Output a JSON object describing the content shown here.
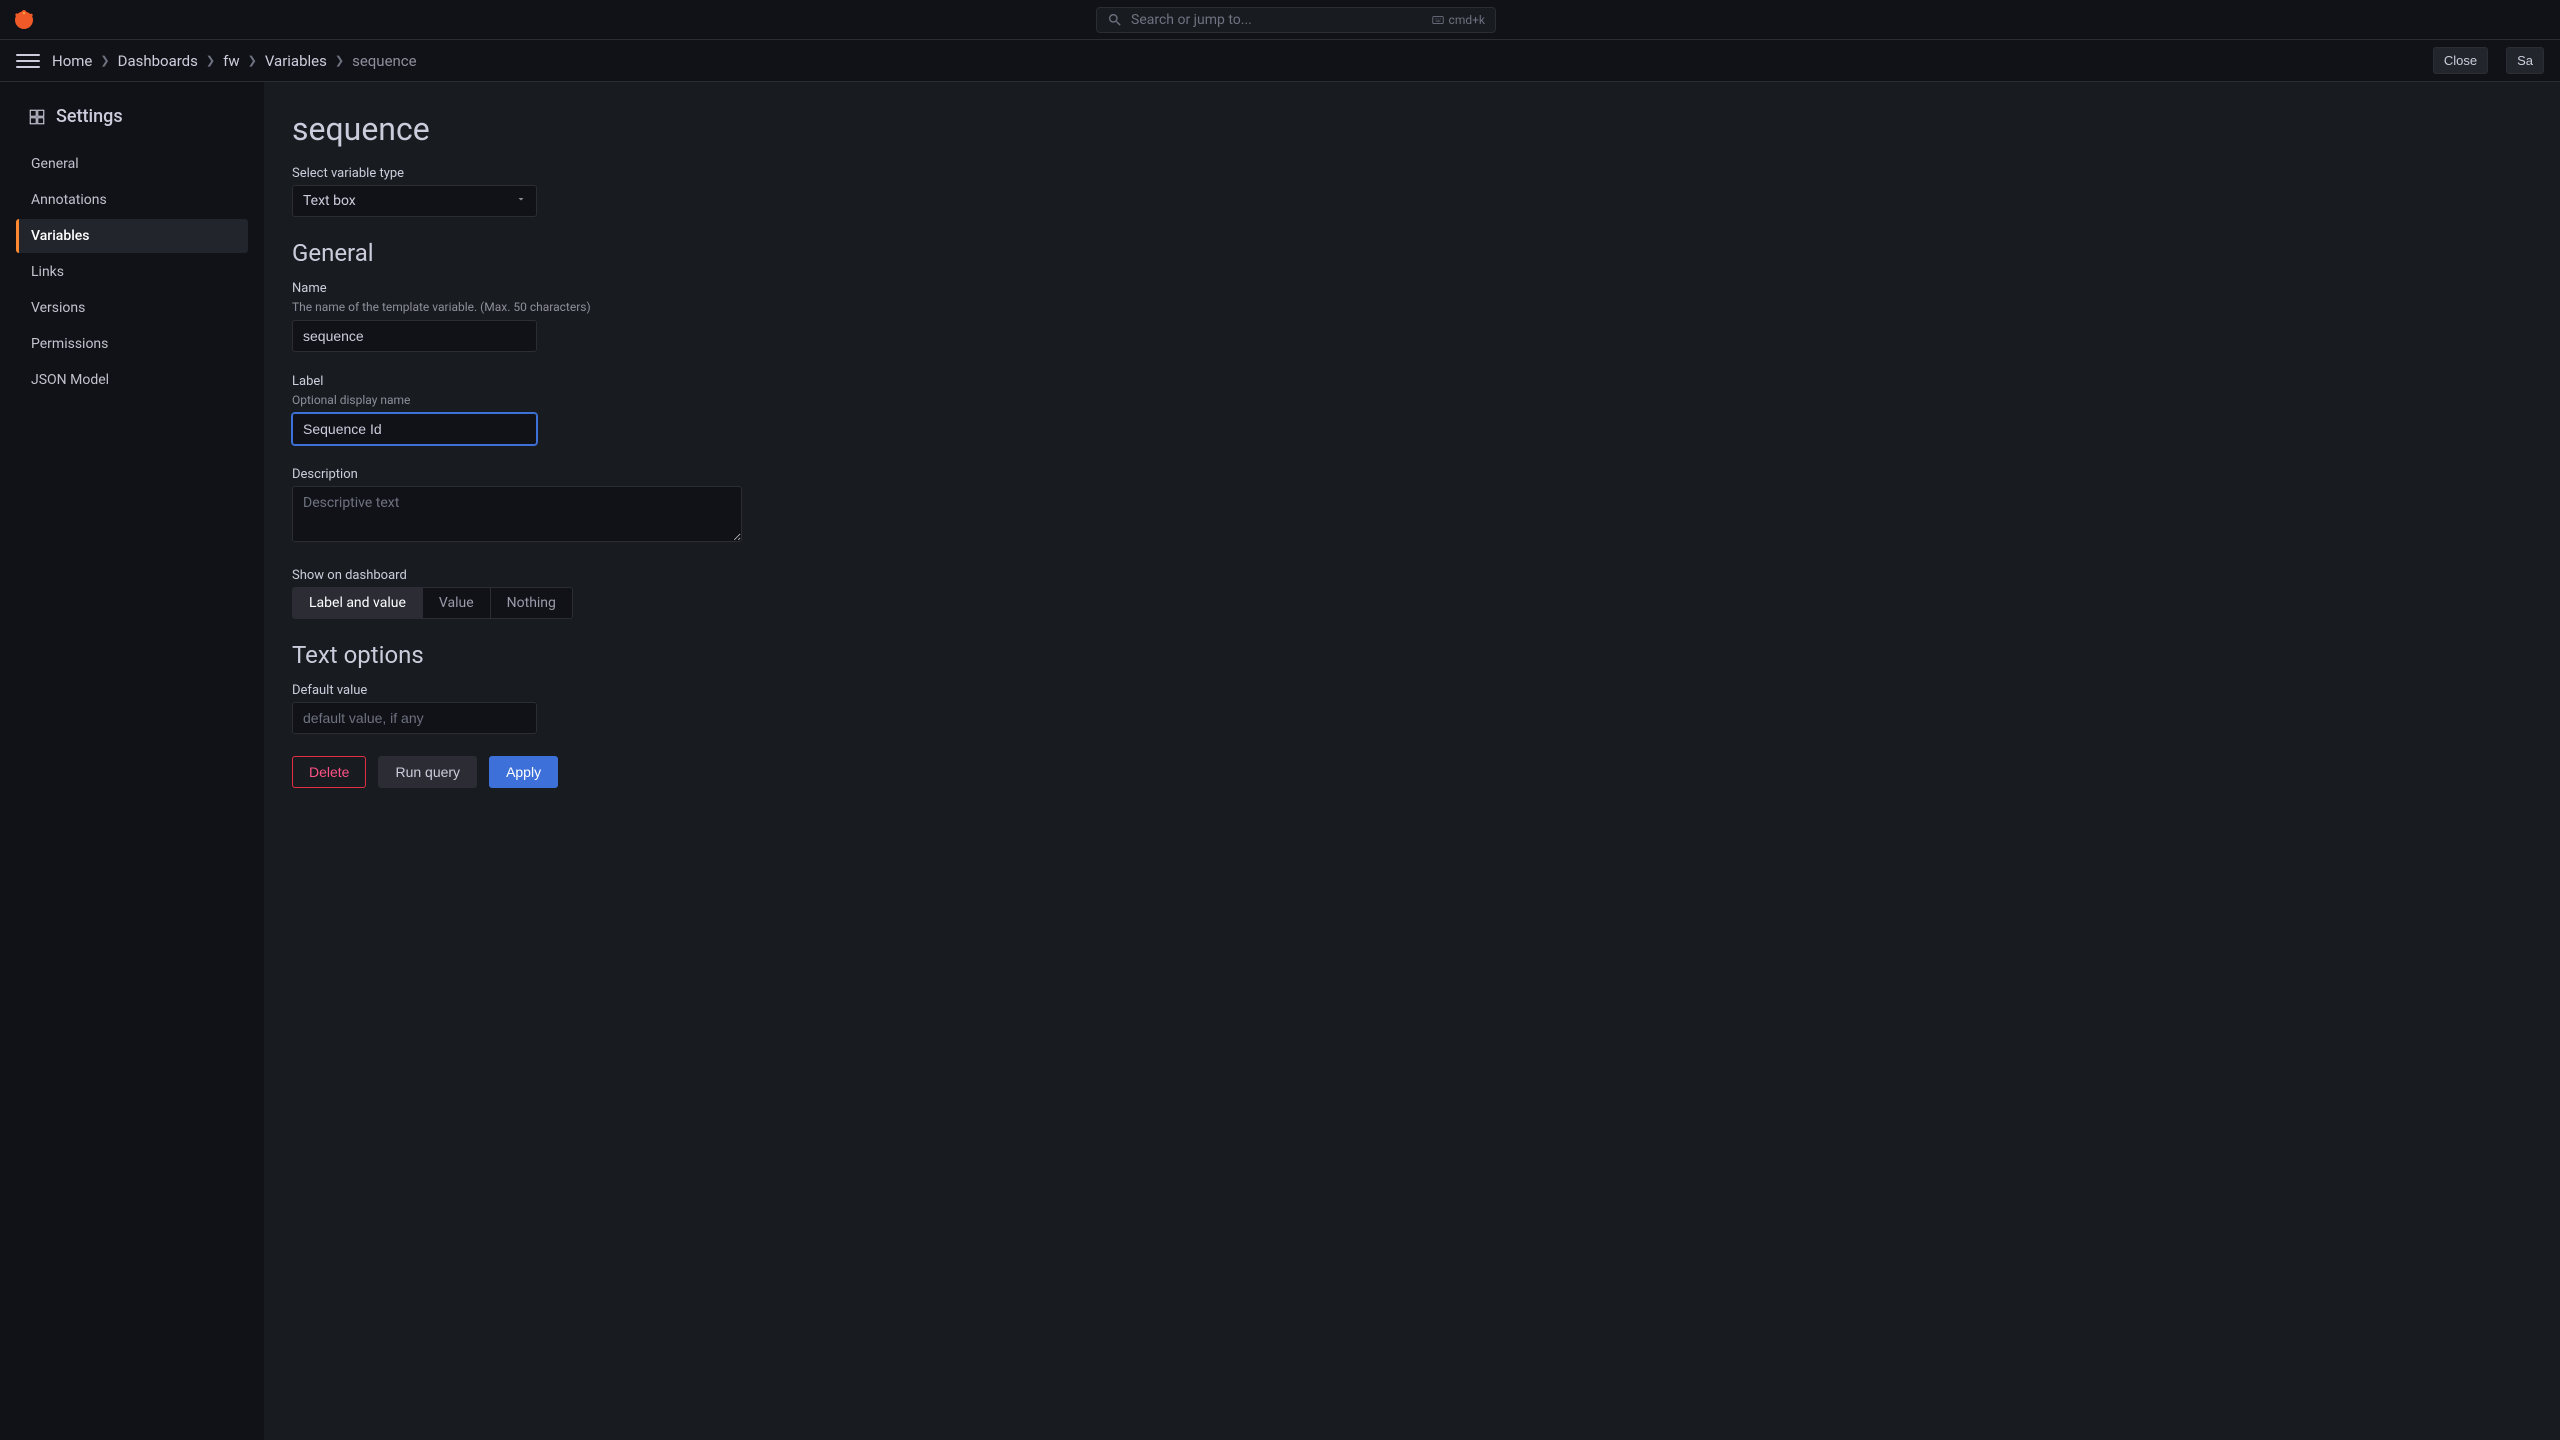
{
  "topbar": {
    "search_placeholder": "Search or jump to...",
    "kbd_hint": "cmd+k"
  },
  "breadcrumbs": {
    "items": [
      "Home",
      "Dashboards",
      "fw",
      "Variables",
      "sequence"
    ],
    "close_label": "Close",
    "save_label": "Sa"
  },
  "sidebar": {
    "title": "Settings",
    "items": [
      {
        "label": "General",
        "active": false
      },
      {
        "label": "Annotations",
        "active": false
      },
      {
        "label": "Variables",
        "active": true
      },
      {
        "label": "Links",
        "active": false
      },
      {
        "label": "Versions",
        "active": false
      },
      {
        "label": "Permissions",
        "active": false
      },
      {
        "label": "JSON Model",
        "active": false
      }
    ]
  },
  "main": {
    "title": "sequence",
    "type_label": "Select variable type",
    "type_value": "Text box",
    "general": {
      "heading": "General",
      "name_label": "Name",
      "name_hint": "The name of the template variable. (Max. 50 characters)",
      "name_value": "sequence",
      "label_label": "Label",
      "label_hint": "Optional display name",
      "label_value": "Sequence Id",
      "desc_label": "Description",
      "desc_placeholder": "Descriptive text",
      "show_label": "Show on dashboard",
      "show_options": [
        "Label and value",
        "Value",
        "Nothing"
      ],
      "show_selected": "Label and value"
    },
    "text_options": {
      "heading": "Text options",
      "default_label": "Default value",
      "default_placeholder": "default value, if any"
    },
    "buttons": {
      "delete": "Delete",
      "run_query": "Run query",
      "apply": "Apply"
    }
  }
}
